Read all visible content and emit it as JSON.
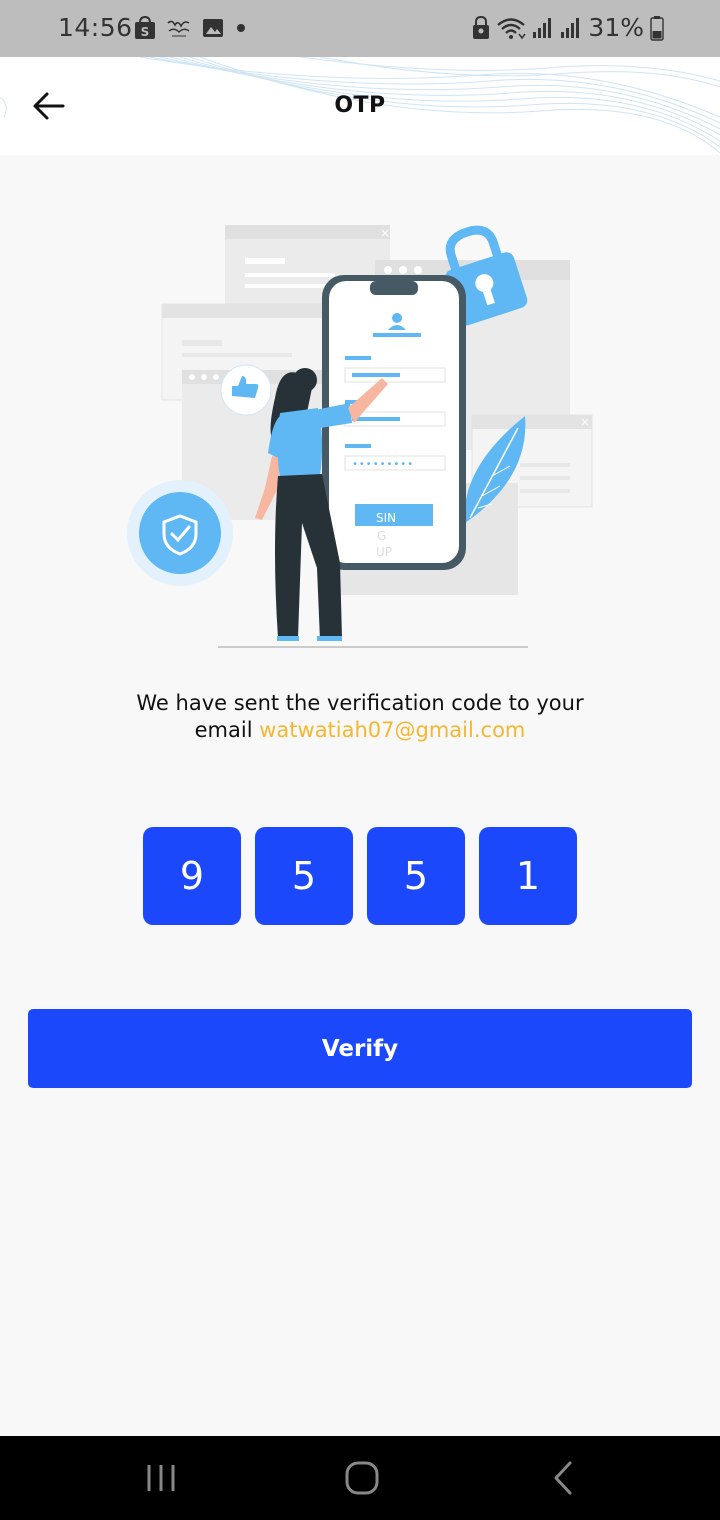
{
  "status_bar": {
    "time": "14:56",
    "battery": "31%",
    "icons": [
      "shopee-icon",
      "app-icon",
      "gallery-icon",
      "dot-icon",
      "lock-icon",
      "wifi-icon",
      "signal-icon",
      "signal-icon",
      "battery-icon"
    ]
  },
  "header": {
    "title": "OTP",
    "back_icon": "arrow-left-icon"
  },
  "illustration": {
    "button_text_1": "SIN",
    "button_text_2": "G",
    "button_text_3": "UP"
  },
  "message": {
    "line1": "We have sent the verification code to your",
    "line2_prefix": "email",
    "email": "watwatiah07@gmail.com"
  },
  "otp": {
    "digits": [
      "9",
      "5",
      "5",
      "1"
    ]
  },
  "verify_label": "Verify",
  "nav": {
    "recent": "recent-apps-icon",
    "home": "home-icon",
    "back": "back-icon"
  },
  "colors": {
    "primary": "#1c48fb",
    "accent_email": "#f5b731",
    "illustration_blue": "#5fb8f3"
  }
}
